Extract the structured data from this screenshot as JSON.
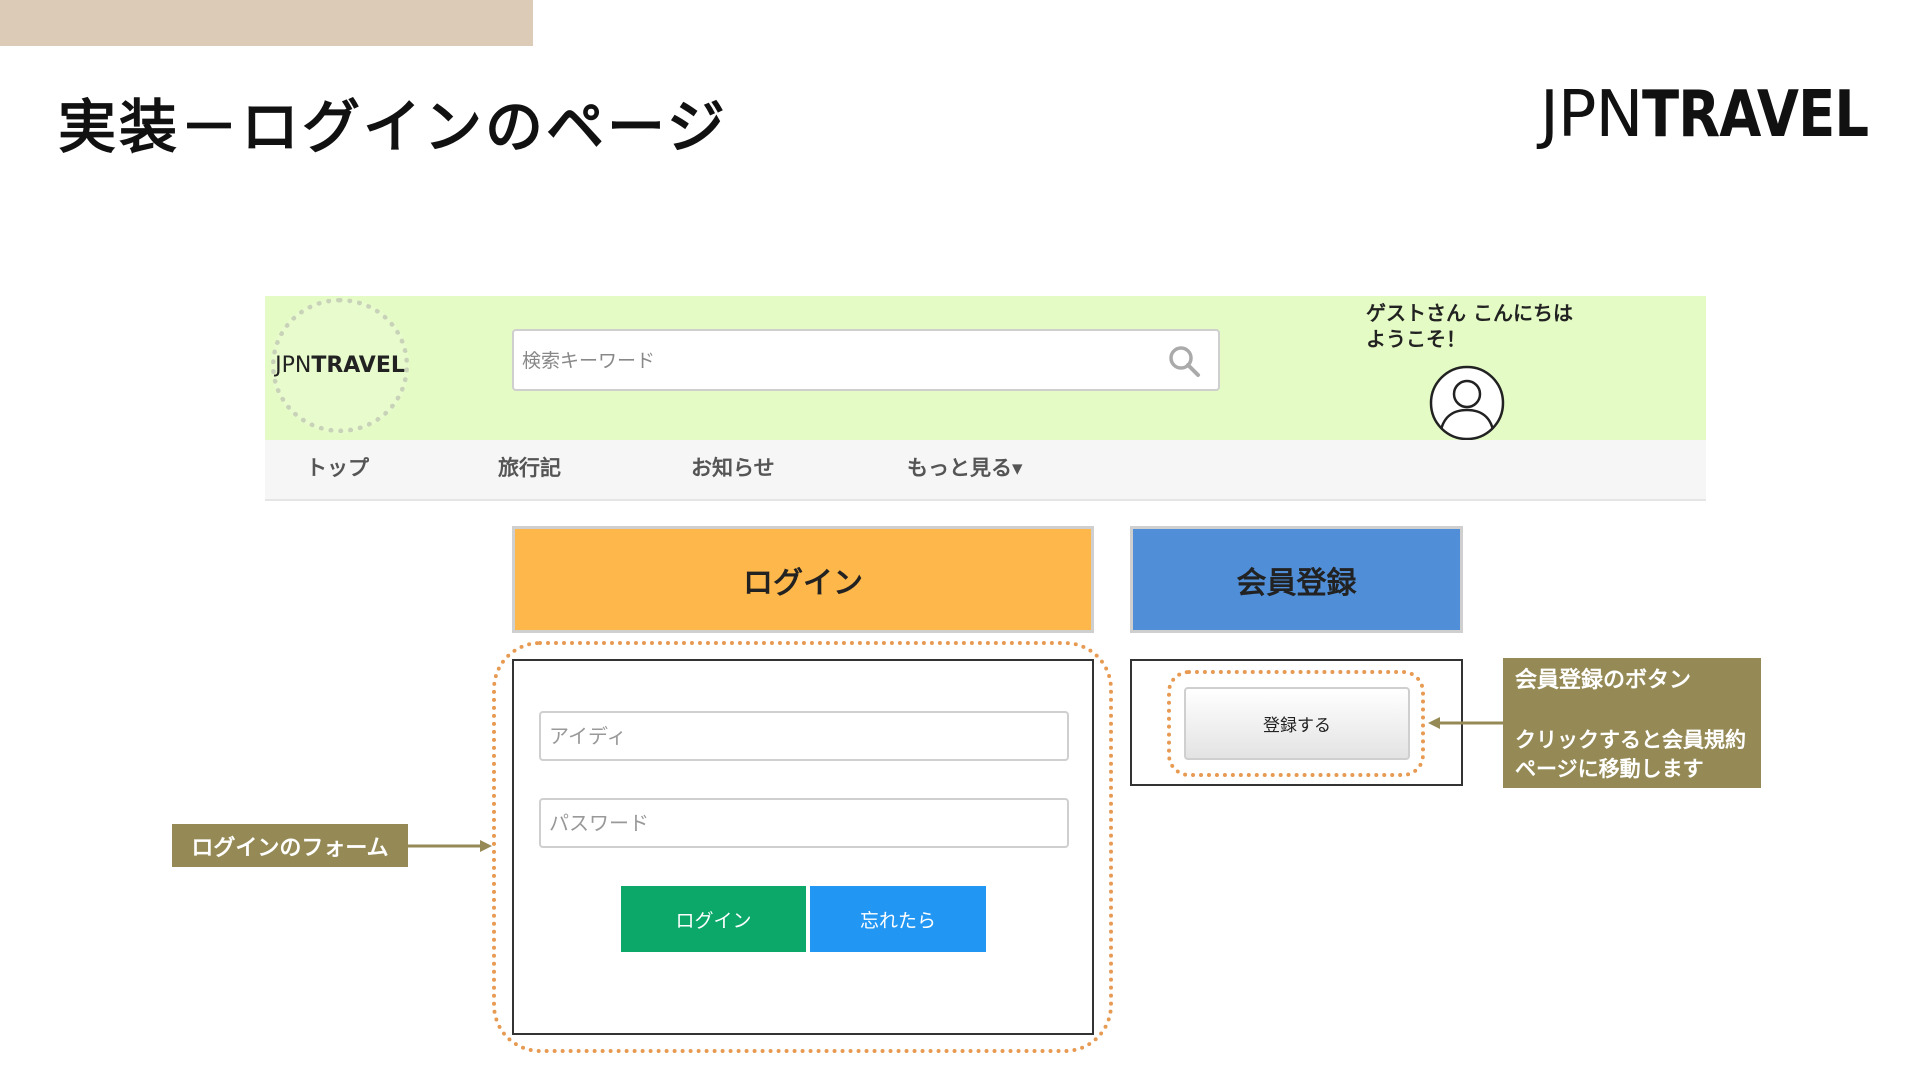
{
  "slide": {
    "title": "実装－ログインのページ",
    "brand_light": "JPN",
    "brand_bold": "TRAVEL"
  },
  "site": {
    "logo_light": "JPN",
    "logo_bold": "TRAVEL",
    "search": {
      "placeholder": "検索キーワード"
    },
    "greeting_line1": "ゲストさん こんにちは",
    "greeting_line2": "ようこそ！",
    "nav": [
      "トップ",
      "旅行記",
      "お知らせ",
      "もっと見る▾"
    ],
    "tabs": {
      "login": "ログイン",
      "register": "会員登録"
    },
    "login_form": {
      "id_placeholder": "アイディ",
      "password_placeholder": "パスワード",
      "login_button": "ログイン",
      "forgot_button": "忘れたら"
    },
    "register_button": "登録する"
  },
  "annotations": {
    "form_label": "ログインのフォーム",
    "register_title": "会員登録のボタン",
    "register_desc": "クリックすると会員規約ページに移動します"
  },
  "colors": {
    "header_bg": "#e4fbc5",
    "login_tab": "#fdb74a",
    "register_tab": "#508fd8",
    "login_btn": "#0ba86a",
    "forgot_btn": "#2196f3",
    "callout": "#958a56",
    "highlight": "#e79a52"
  }
}
